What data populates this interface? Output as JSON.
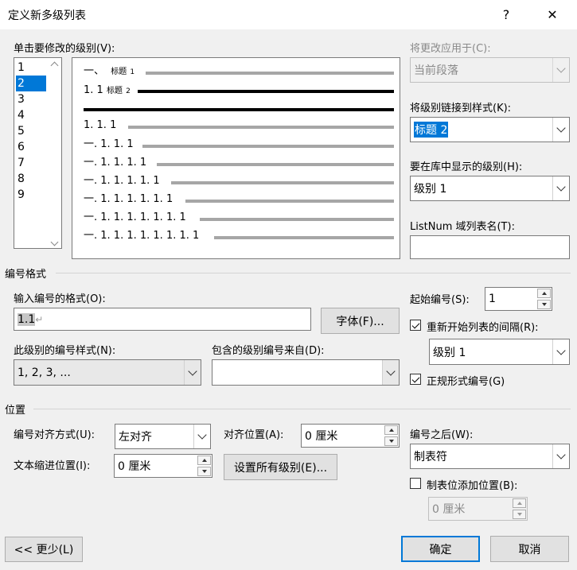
{
  "window": {
    "title": "定义新多级列表",
    "help": "?",
    "close": "✕"
  },
  "levels": {
    "label": "单击要修改的级别(V):",
    "items": [
      "1",
      "2",
      "3",
      "4",
      "5",
      "6",
      "7",
      "8",
      "9"
    ],
    "selected": 1
  },
  "preview": {
    "rows": [
      {
        "prefix": "一、",
        "tag": "标题",
        "tagnum": "1"
      },
      {
        "prefix": "1. 1",
        "tag": "标题",
        "tagnum": "2"
      },
      {
        "prefix": ""
      },
      {
        "prefix": "1. 1. 1"
      },
      {
        "prefix": "一. 1. 1. 1"
      },
      {
        "prefix": "一. 1. 1. 1. 1"
      },
      {
        "prefix": "一. 1. 1. 1. 1. 1"
      },
      {
        "prefix": "一. 1. 1. 1. 1. 1. 1"
      },
      {
        "prefix": "一. 1. 1. 1. 1. 1. 1. 1"
      },
      {
        "prefix": "一. 1. 1. 1. 1. 1. 1. 1. 1"
      }
    ]
  },
  "apply_to": {
    "label": "将更改应用于(C):",
    "value": "当前段落"
  },
  "link_style": {
    "label": "将级别链接到样式(K):",
    "value": "标题 2"
  },
  "gallery_level": {
    "label": "要在库中显示的级别(H):",
    "value": "级别 1"
  },
  "listnum": {
    "label": "ListNum 域列表名(T):",
    "value": ""
  },
  "number_format": {
    "group": "编号格式",
    "format_label": "输入编号的格式(O):",
    "format_value": "1.1",
    "font_button": "字体(F)...",
    "style_label": "此级别的编号样式(N):",
    "style_value": "1, 2, 3, ...",
    "include_label": "包含的级别编号来自(D):",
    "include_value": "",
    "start_label": "起始编号(S):",
    "start_value": "1",
    "restart_label": "重新开始列表的间隔(R):",
    "restart_value": "级别 1",
    "legal_label": "正规形式编号(G)"
  },
  "position": {
    "group": "位置",
    "align_label": "编号对齐方式(U):",
    "align_value": "左对齐",
    "at_label": "对齐位置(A):",
    "at_value": "0 厘米",
    "indent_label": "文本缩进位置(I):",
    "indent_value": "0 厘米",
    "set_all_button": "设置所有级别(E)...",
    "follow_label": "编号之后(W):",
    "follow_value": "制表符",
    "tab_add_label": "制表位添加位置(B):",
    "tab_add_value": "0 厘米"
  },
  "buttons": {
    "less": "<< 更少(L)",
    "ok": "确定",
    "cancel": "取消"
  },
  "colors": {
    "accent": "#0078d7",
    "bar_grey": "#a6a6a6"
  }
}
